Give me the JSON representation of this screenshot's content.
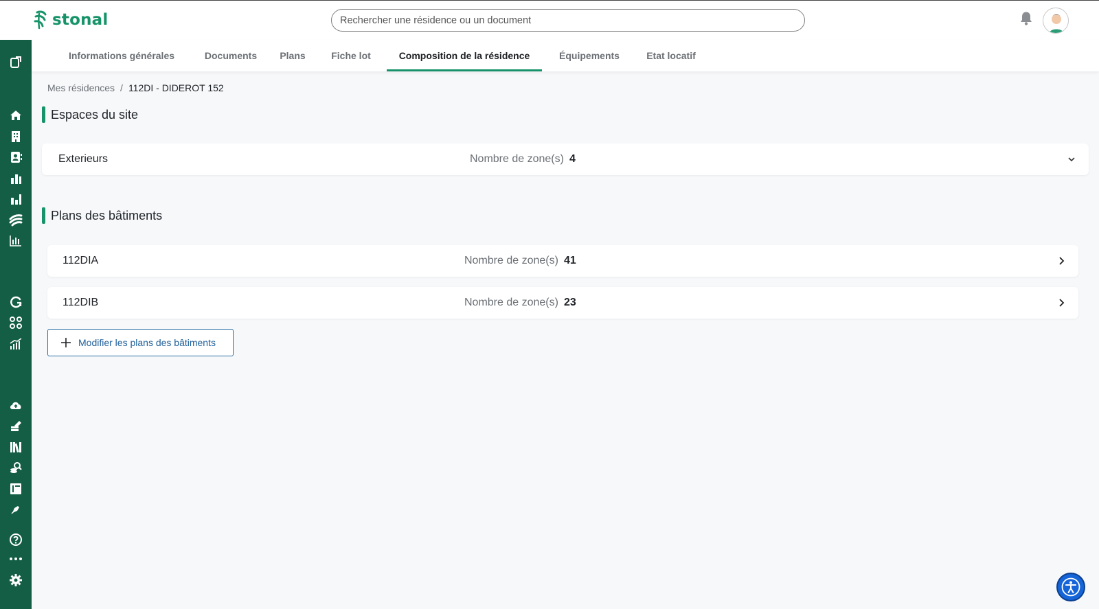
{
  "app": {
    "brand": "stonal",
    "brand_color": "#17936a",
    "sidebar_color": "#135e45"
  },
  "header": {
    "search_placeholder": "Rechercher une résidence ou un document",
    "icons": [
      "bell-icon",
      "avatar"
    ]
  },
  "sidebar": {
    "icons": [
      "logout-icon",
      "home-icon",
      "building-icon",
      "contacts-icon",
      "bar-chart-icon",
      "bar-chart-alt-icon",
      "wave-icon",
      "analytics-icon",
      "refresh-icon",
      "apps-icon",
      "growth-chart-icon",
      "cloud-upload-icon",
      "edit-stack-icon",
      "library-icon",
      "search-coins-icon",
      "layout-icon",
      "pen-icon",
      "help-icon",
      "more-icon",
      "settings-icon"
    ]
  },
  "tabs": [
    {
      "label": "Informations générales",
      "active": false
    },
    {
      "label": "Documents",
      "active": false
    },
    {
      "label": "Plans",
      "active": false
    },
    {
      "label": "Fiche lot",
      "active": false
    },
    {
      "label": "Composition de la résidence",
      "active": true
    },
    {
      "label": "Équipements",
      "active": false
    },
    {
      "label": "Etat locatif",
      "active": false
    }
  ],
  "breadcrumb": {
    "parent": "Mes résidences",
    "separator": "/",
    "current": "112DI - DIDEROT 152"
  },
  "site_spaces": {
    "title": "Espaces du site",
    "items": [
      {
        "name": "Exterieurs",
        "zones_label": "Nombre de zone(s)",
        "zones": "4"
      }
    ]
  },
  "building_plans": {
    "title": "Plans des bâtiments",
    "items": [
      {
        "name": "112DIA",
        "zones_label": "Nombre de zone(s)",
        "zones": "41"
      },
      {
        "name": "112DIB",
        "zones_label": "Nombre de zone(s)",
        "zones": "23"
      }
    ],
    "modify_button": "Modifier les plans des bâtiments"
  }
}
